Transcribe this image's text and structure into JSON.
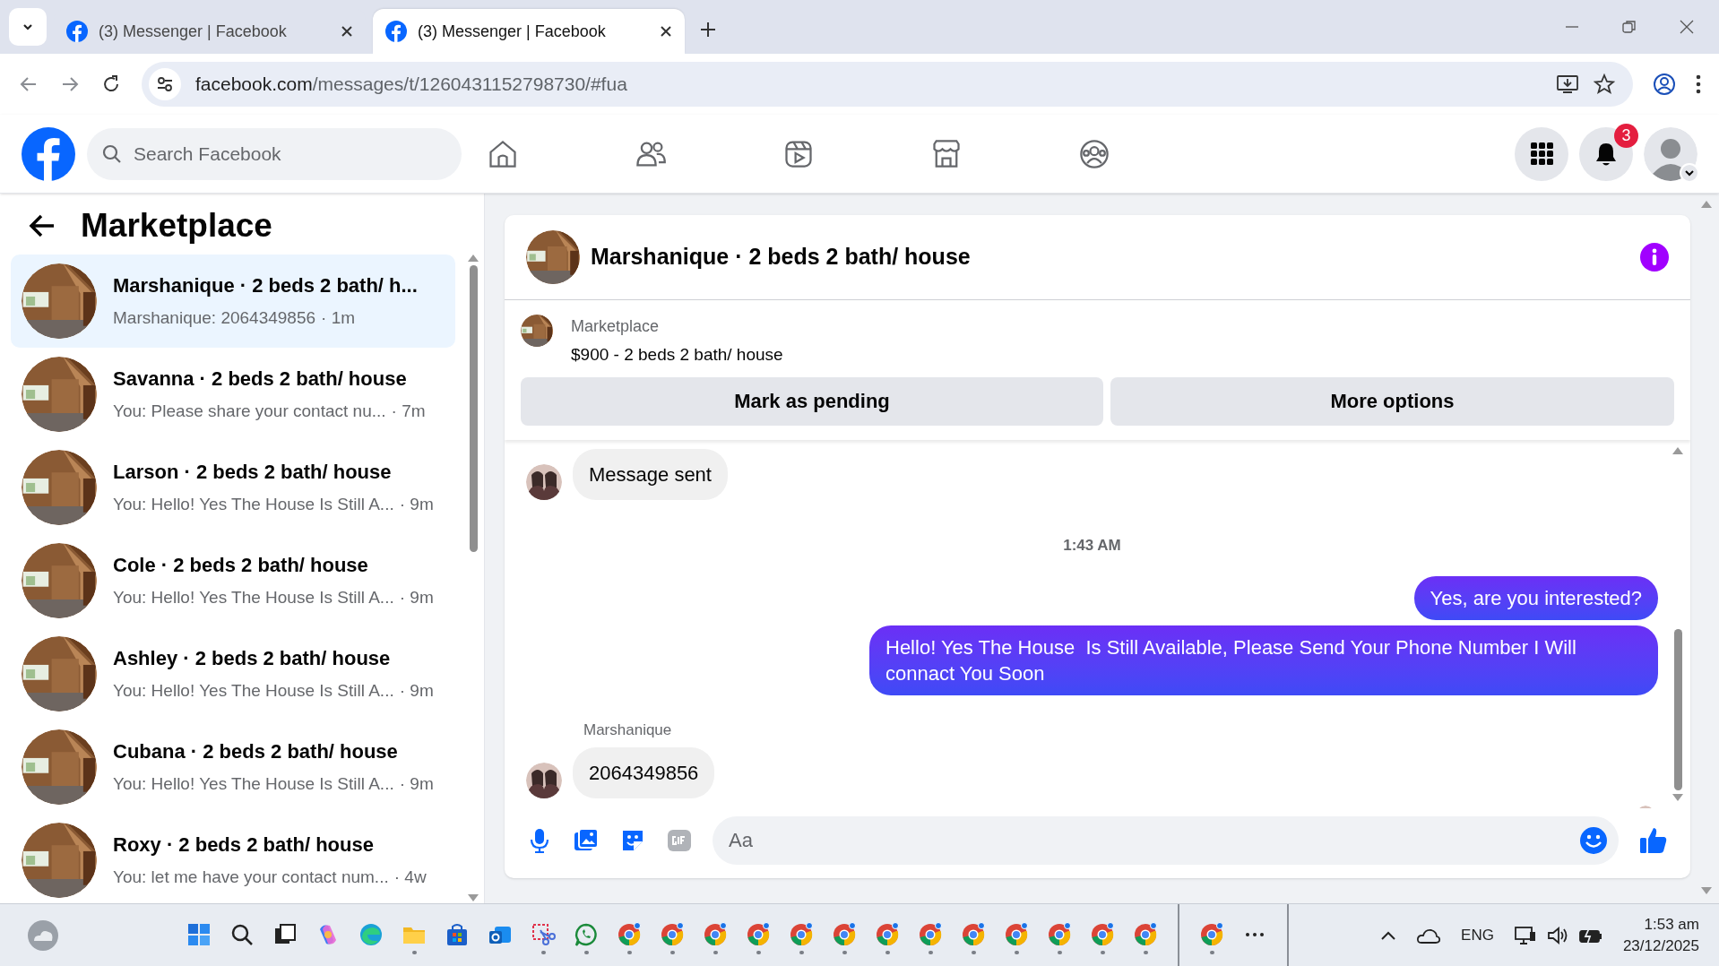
{
  "browser": {
    "tabs": [
      {
        "title": "(3) Messenger | Facebook",
        "selected": false
      },
      {
        "title": "(3) Messenger | Facebook",
        "selected": true
      }
    ],
    "url_host": "facebook.com",
    "url_path": "/messages/t/1260431152798730/#fua"
  },
  "header": {
    "search": {
      "placeholder": "Search Facebook"
    },
    "notifications": "3"
  },
  "sidebar": {
    "title": "Marketplace",
    "conversations": [
      {
        "title": "Marshanique · 2 beds 2 bath/ h...",
        "preview": "Marshanique: 2064349856",
        "time": "· 1m",
        "selected": true
      },
      {
        "title": "Savanna · 2 beds 2 bath/ house",
        "preview": "You: Please share your contact nu...",
        "time": "· 7m",
        "selected": false
      },
      {
        "title": "Larson · 2 beds 2 bath/ house",
        "preview": "You: Hello! Yes The House Is Still A...",
        "time": "· 9m",
        "selected": false
      },
      {
        "title": "Cole · 2 beds 2 bath/ house",
        "preview": "You: Hello! Yes The House Is Still A...",
        "time": "· 9m",
        "selected": false
      },
      {
        "title": "Ashley · 2 beds 2 bath/ house",
        "preview": "You: Hello! Yes The House Is Still A...",
        "time": "· 9m",
        "selected": false
      },
      {
        "title": "Cubana · 2 beds 2 bath/ house",
        "preview": "You: Hello! Yes The House Is Still A...",
        "time": "· 9m",
        "selected": false
      },
      {
        "title": "Roxy · 2 beds 2 bath/ house",
        "preview": "You: let me have your contact num...",
        "time": "· 4w",
        "selected": false
      }
    ]
  },
  "chat": {
    "title": "Marshanique · 2 beds 2 bath/ house",
    "listing": {
      "source": "Marketplace",
      "title": "$900 - 2 beds 2 bath/ house"
    },
    "actions": [
      "Mark as pending",
      "More options"
    ],
    "messages": [
      {
        "kind": "incoming",
        "text": "Message sent"
      },
      {
        "kind": "time",
        "text": "1:43 AM"
      },
      {
        "kind": "outgoing",
        "text": "Yes, are you interested?"
      },
      {
        "kind": "outgoing",
        "text": "Hello! Yes The House  Is Still Available, Please Send Your Phone Number I Will connact You Soon"
      },
      {
        "kind": "incoming",
        "sender": "Marshanique",
        "text": "2064349856"
      }
    ],
    "composer": {
      "placeholder": "Aa"
    }
  },
  "taskbar": {
    "language": "ENG",
    "time": "1:53 am",
    "date": "23/12/2025"
  }
}
